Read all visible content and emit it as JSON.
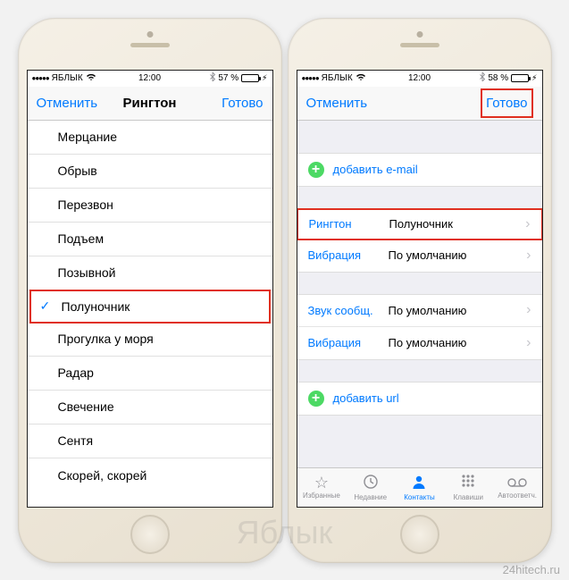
{
  "status": {
    "carrier": "ЯБЛЫК",
    "time": "12:00",
    "battery1": "57 %",
    "battery2": "58 %"
  },
  "phone1": {
    "nav": {
      "cancel": "Отменить",
      "title": "Рингтон",
      "done": "Готово"
    },
    "ringtones": [
      "Мерцание",
      "Обрыв",
      "Перезвон",
      "Подъем",
      "Позывной",
      "Полуночник",
      "Прогулка у моря",
      "Радар",
      "Свечение",
      "Сентя",
      "Скорей, скорей"
    ],
    "selected_index": 5
  },
  "phone2": {
    "nav": {
      "cancel": "Отменить",
      "done": "Готово"
    },
    "add_email": "добавить e-mail",
    "ringtone": {
      "label": "Рингтон",
      "value": "Полуночник"
    },
    "vibration1": {
      "label": "Вибрация",
      "value": "По умолчанию"
    },
    "text_tone": {
      "label": "Звук сообщ.",
      "value": "По умолчанию"
    },
    "vibration2": {
      "label": "Вибрация",
      "value": "По умолчанию"
    },
    "add_url": "добавить url",
    "tabs": {
      "favorites": "Избранные",
      "recents": "Недавние",
      "contacts": "Контакты",
      "keypad": "Клавиши",
      "voicemail": "Автоответч."
    }
  },
  "watermark": "Яблык",
  "watermark2": "24hitech.ru"
}
